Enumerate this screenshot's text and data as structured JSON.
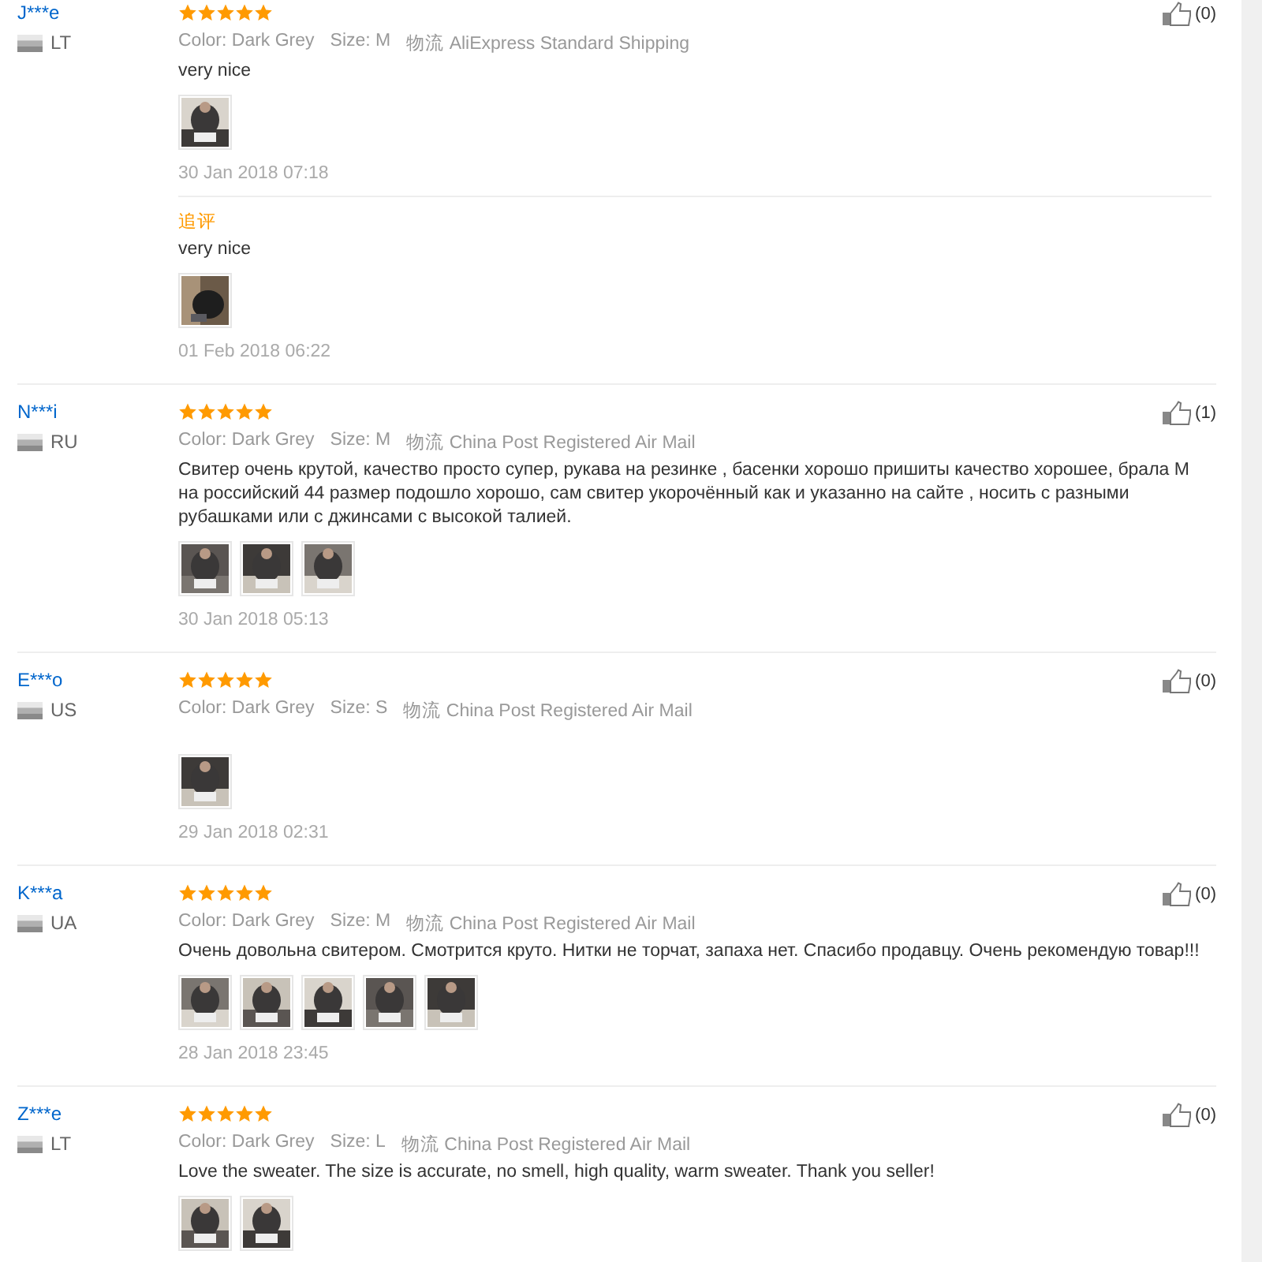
{
  "reviews": [
    {
      "user": "J***e",
      "country": "LT",
      "stars": 5,
      "sku": [
        {
          "label": "Color:",
          "value": "Dark Grey"
        },
        {
          "label": "Size:",
          "value": "M"
        },
        {
          "label": "物流",
          "value": "AliExpress Standard Shipping"
        }
      ],
      "text": "very nice",
      "photos": [
        {
          "kind": "picture"
        }
      ],
      "date": "30 Jan 2018 07:18",
      "followup": {
        "label": "追评",
        "text": "very nice",
        "photos": [
          {
            "kind": "picture"
          }
        ],
        "date": "01 Feb 2018 06:22"
      },
      "likes": "(0)"
    },
    {
      "user": "N***i",
      "country": "RU",
      "stars": 5,
      "sku": [
        {
          "label": "Color:",
          "value": "Dark Grey"
        },
        {
          "label": "Size:",
          "value": "M"
        },
        {
          "label": "物流",
          "value": "China Post Registered Air Mail"
        }
      ],
      "text": "Свитер очень крутой, качество просто супер, рукава на резинке , басенки хорошо пришиты качество хорошее, брала М на российский 44 размер подошло хорошо, сам свитер укорочённый как и указанно на сайте , носить с разными рубашками или с джинсами с высокой талией.",
      "photos": [
        {
          "kind": "picture"
        },
        {
          "kind": "picture"
        },
        {
          "kind": "picture"
        }
      ],
      "date": "30 Jan 2018 05:13",
      "likes": "(1)"
    },
    {
      "user": "E***o",
      "country": "US",
      "stars": 5,
      "sku": [
        {
          "label": "Color:",
          "value": "Dark Grey"
        },
        {
          "label": "Size:",
          "value": "S"
        },
        {
          "label": "物流",
          "value": "China Post Registered Air Mail"
        }
      ],
      "photos": [
        {
          "kind": "picture"
        }
      ],
      "date": "29 Jan 2018 02:31",
      "likes": "(0)"
    },
    {
      "user": "K***a",
      "country": "UA",
      "stars": 5,
      "sku": [
        {
          "label": "Color:",
          "value": "Dark Grey"
        },
        {
          "label": "Size:",
          "value": "M"
        },
        {
          "label": "物流",
          "value": "China Post Registered Air Mail"
        }
      ],
      "text": "Очень довольна свитером. Смотрится круто. Нитки не торчат, запаха нет. Спасибо продавцу. Очень рекомендую товар!!!",
      "photos": [
        {
          "kind": "picture"
        },
        {
          "kind": "picture"
        },
        {
          "kind": "picture"
        },
        {
          "kind": "picture"
        },
        {
          "kind": "picture"
        }
      ],
      "date": "28 Jan 2018 23:45",
      "likes": "(0)"
    },
    {
      "user": "Z***e",
      "country": "LT",
      "stars": 5,
      "sku": [
        {
          "label": "Color:",
          "value": "Dark Grey"
        },
        {
          "label": "Size:",
          "value": "L"
        },
        {
          "label": "物流",
          "value": "China Post Registered Air Mail"
        }
      ],
      "text": "Love the sweater. The size is accurate, no smell, high quality, warm sweater. Thank you seller!",
      "photos": [
        {
          "kind": "picture"
        },
        {
          "kind": "picture"
        }
      ],
      "likes": "(0)"
    }
  ]
}
